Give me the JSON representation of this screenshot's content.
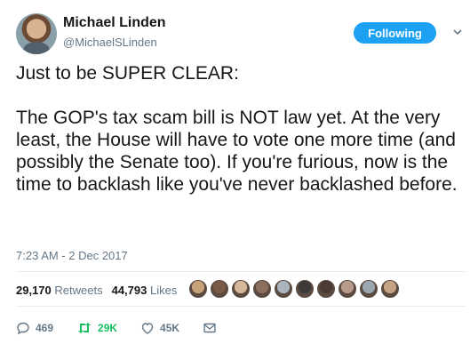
{
  "user": {
    "name": "Michael Linden",
    "handle": "@MichaelSLinden",
    "follow_label": "Following"
  },
  "tweet": {
    "text": "Just to be SUPER CLEAR:\n\nThe GOP's tax scam bill is NOT law yet. At the very least, the House will have to vote one more time (and possibly the Senate too). If you're furious, now is the time to backlash like you've never backlashed before.",
    "timestamp": "7:23 AM - 2 Dec 2017"
  },
  "stats": {
    "retweets_count": "29,170",
    "retweets_label": "Retweets",
    "likes_count": "44,793",
    "likes_label": "Likes"
  },
  "likers": {
    "colors": [
      "#c9a27a",
      "#7a5a45",
      "#d8b89a",
      "#8c6e5c",
      "#a9b4bd",
      "#3d3a3a",
      "#4a3b35",
      "#b89a8a",
      "#9aa7b0",
      "#c7a386"
    ]
  },
  "actions": {
    "reply_count": "469",
    "retweet_count": "29K",
    "like_count": "45K"
  },
  "colors": {
    "accent": "#1da1f2",
    "retweet": "#17bf63",
    "muted": "#657786"
  }
}
